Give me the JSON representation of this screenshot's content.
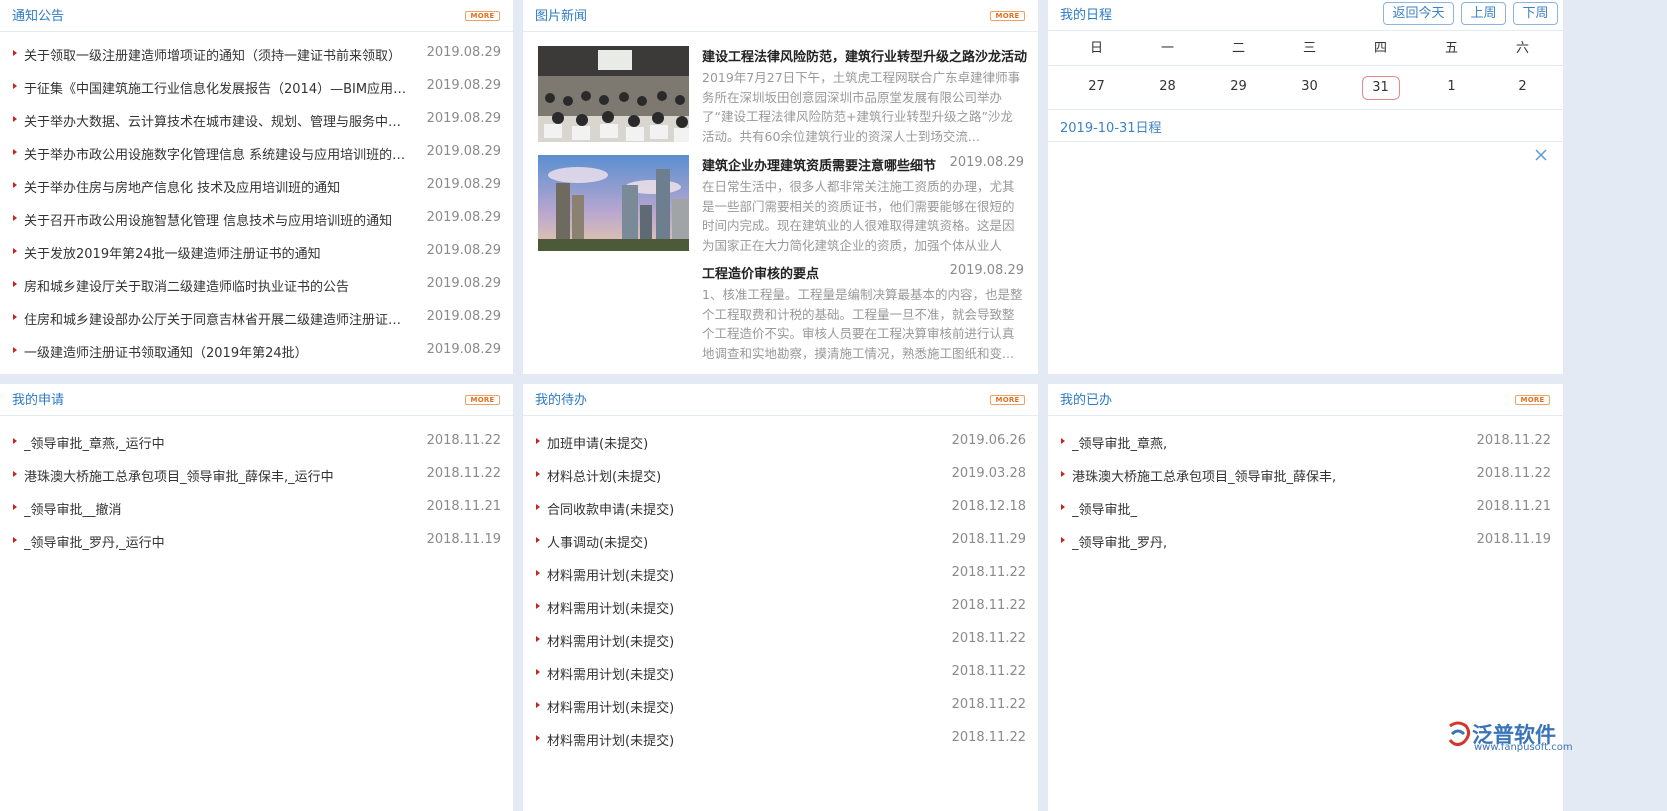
{
  "notices": {
    "title": "通知公告",
    "more": "MORE",
    "items": [
      {
        "text": "关于领取一级注册建造师增项证的通知（须持一建证书前来领取）",
        "date": "2019.08.29"
      },
      {
        "text": "于征集《中国建筑施工行业信息化发展报告（2014）—BIM应用与发...",
        "date": "2019.08.29"
      },
      {
        "text": "关于举办大数据、云计算技术在城市建设、规划、管理与服务中的应...",
        "date": "2019.08.29"
      },
      {
        "text": "关于举办市政公用设施数字化管理信息 系统建设与应用培训班的通知",
        "date": "2019.08.29"
      },
      {
        "text": "关于举办住房与房地产信息化 技术及应用培训班的通知",
        "date": "2019.08.29"
      },
      {
        "text": "关于召开市政公用设施智慧化管理 信息技术与应用培训班的通知",
        "date": "2019.08.29"
      },
      {
        "text": "关于发放2019年第24批一级建造师注册证书的通知",
        "date": "2019.08.29"
      },
      {
        "text": "房和城乡建设厅关于取消二级建造师临时执业证书的公告",
        "date": "2019.08.29"
      },
      {
        "text": "住房和城乡建设部办公厅关于同意吉林省开展二级建造师注册证书电...",
        "date": "2019.08.29"
      },
      {
        "text": "一级建造师注册证书领取通知（2019年第24批）",
        "date": "2019.08.29"
      }
    ]
  },
  "photo_news": {
    "title": "图片新闻",
    "more": "MORE",
    "items": [
      {
        "title": "建设工程法律风险防范，建筑行业转型升级之路沙龙活动",
        "date": "",
        "desc": "2019年7月27日下午，土筑虎工程网联合广东卓建律师事务所在深圳坂田创意园深圳市品原堂发展有限公司举办了“建设工程法律风险防范+建筑行业转型升级之路”沙龙活动。共有60余位建筑行业的资深人士到场交流..."
      },
      {
        "title": "建筑企业办理建筑资质需要注意哪些细节",
        "date": "2019.08.29",
        "desc": "在日常生活中，很多人都非常关注施工资质的办理，尤其是一些部门需要相关的资质证书，他们需要能够在很短的时间内完成。现在建筑业的人很难取得建筑资格。这是因为国家正在大力简化建筑企业的资质，加强个体从业人员..."
      },
      {
        "title": "工程造价审核的要点",
        "date": "2019.08.29",
        "desc": "1、核准工程量。工程量是编制决算最基本的内容，也是整个工程取费和计税的基础。工程量一旦不准，就会导致整个工程造价不实。审核人员要在工程决算审核前进行认真地调查和实地勘察，摸清施工情况，熟悉施工图纸和变..."
      }
    ]
  },
  "schedule": {
    "title": "我的日程",
    "btn_today": "返回今天",
    "btn_prev": "上周",
    "btn_next": "下周",
    "weekdays": [
      "日",
      "一",
      "二",
      "三",
      "四",
      "五",
      "六"
    ],
    "days": [
      "27",
      "28",
      "29",
      "30",
      "31",
      "1",
      "2"
    ],
    "today_index": 4,
    "schedule_label": "2019-10-31日程"
  },
  "applications": {
    "title": "我的申请",
    "more": "MORE",
    "items": [
      {
        "text": "_领导审批_章燕,_运行中",
        "date": "2018.11.22"
      },
      {
        "text": "港珠澳大桥施工总承包项目_领导审批_薛保丰,_运行中",
        "date": "2018.11.22"
      },
      {
        "text": "_领导审批__撤消",
        "date": "2018.11.21"
      },
      {
        "text": "_领导审批_罗丹,_运行中",
        "date": "2018.11.19"
      }
    ]
  },
  "todo": {
    "title": "我的待办",
    "more": "MORE",
    "items": [
      {
        "text": "加班申请(未提交)",
        "date": "2019.06.26"
      },
      {
        "text": "材料总计划(未提交)",
        "date": "2019.03.28"
      },
      {
        "text": "合同收款申请(未提交)",
        "date": "2018.12.18"
      },
      {
        "text": "人事调动(未提交)",
        "date": "2018.11.29"
      },
      {
        "text": "材料需用计划(未提交)",
        "date": "2018.11.22"
      },
      {
        "text": "材料需用计划(未提交)",
        "date": "2018.11.22"
      },
      {
        "text": "材料需用计划(未提交)",
        "date": "2018.11.22"
      },
      {
        "text": "材料需用计划(未提交)",
        "date": "2018.11.22"
      },
      {
        "text": "材料需用计划(未提交)",
        "date": "2018.11.22"
      },
      {
        "text": "材料需用计划(未提交)",
        "date": "2018.11.22"
      }
    ]
  },
  "done": {
    "title": "我的已办",
    "more": "MORE",
    "items": [
      {
        "text": "_领导审批_章燕,",
        "date": "2018.11.22"
      },
      {
        "text": "港珠澳大桥施工总承包项目_领导审批_薛保丰,",
        "date": "2018.11.22"
      },
      {
        "text": "_领导审批_",
        "date": "2018.11.21"
      },
      {
        "text": "_领导审批_罗丹,",
        "date": "2018.11.19"
      }
    ]
  },
  "brand": {
    "name": "泛普软件",
    "url": "www.fanpusoft.com",
    "color": "#3a74b8"
  }
}
